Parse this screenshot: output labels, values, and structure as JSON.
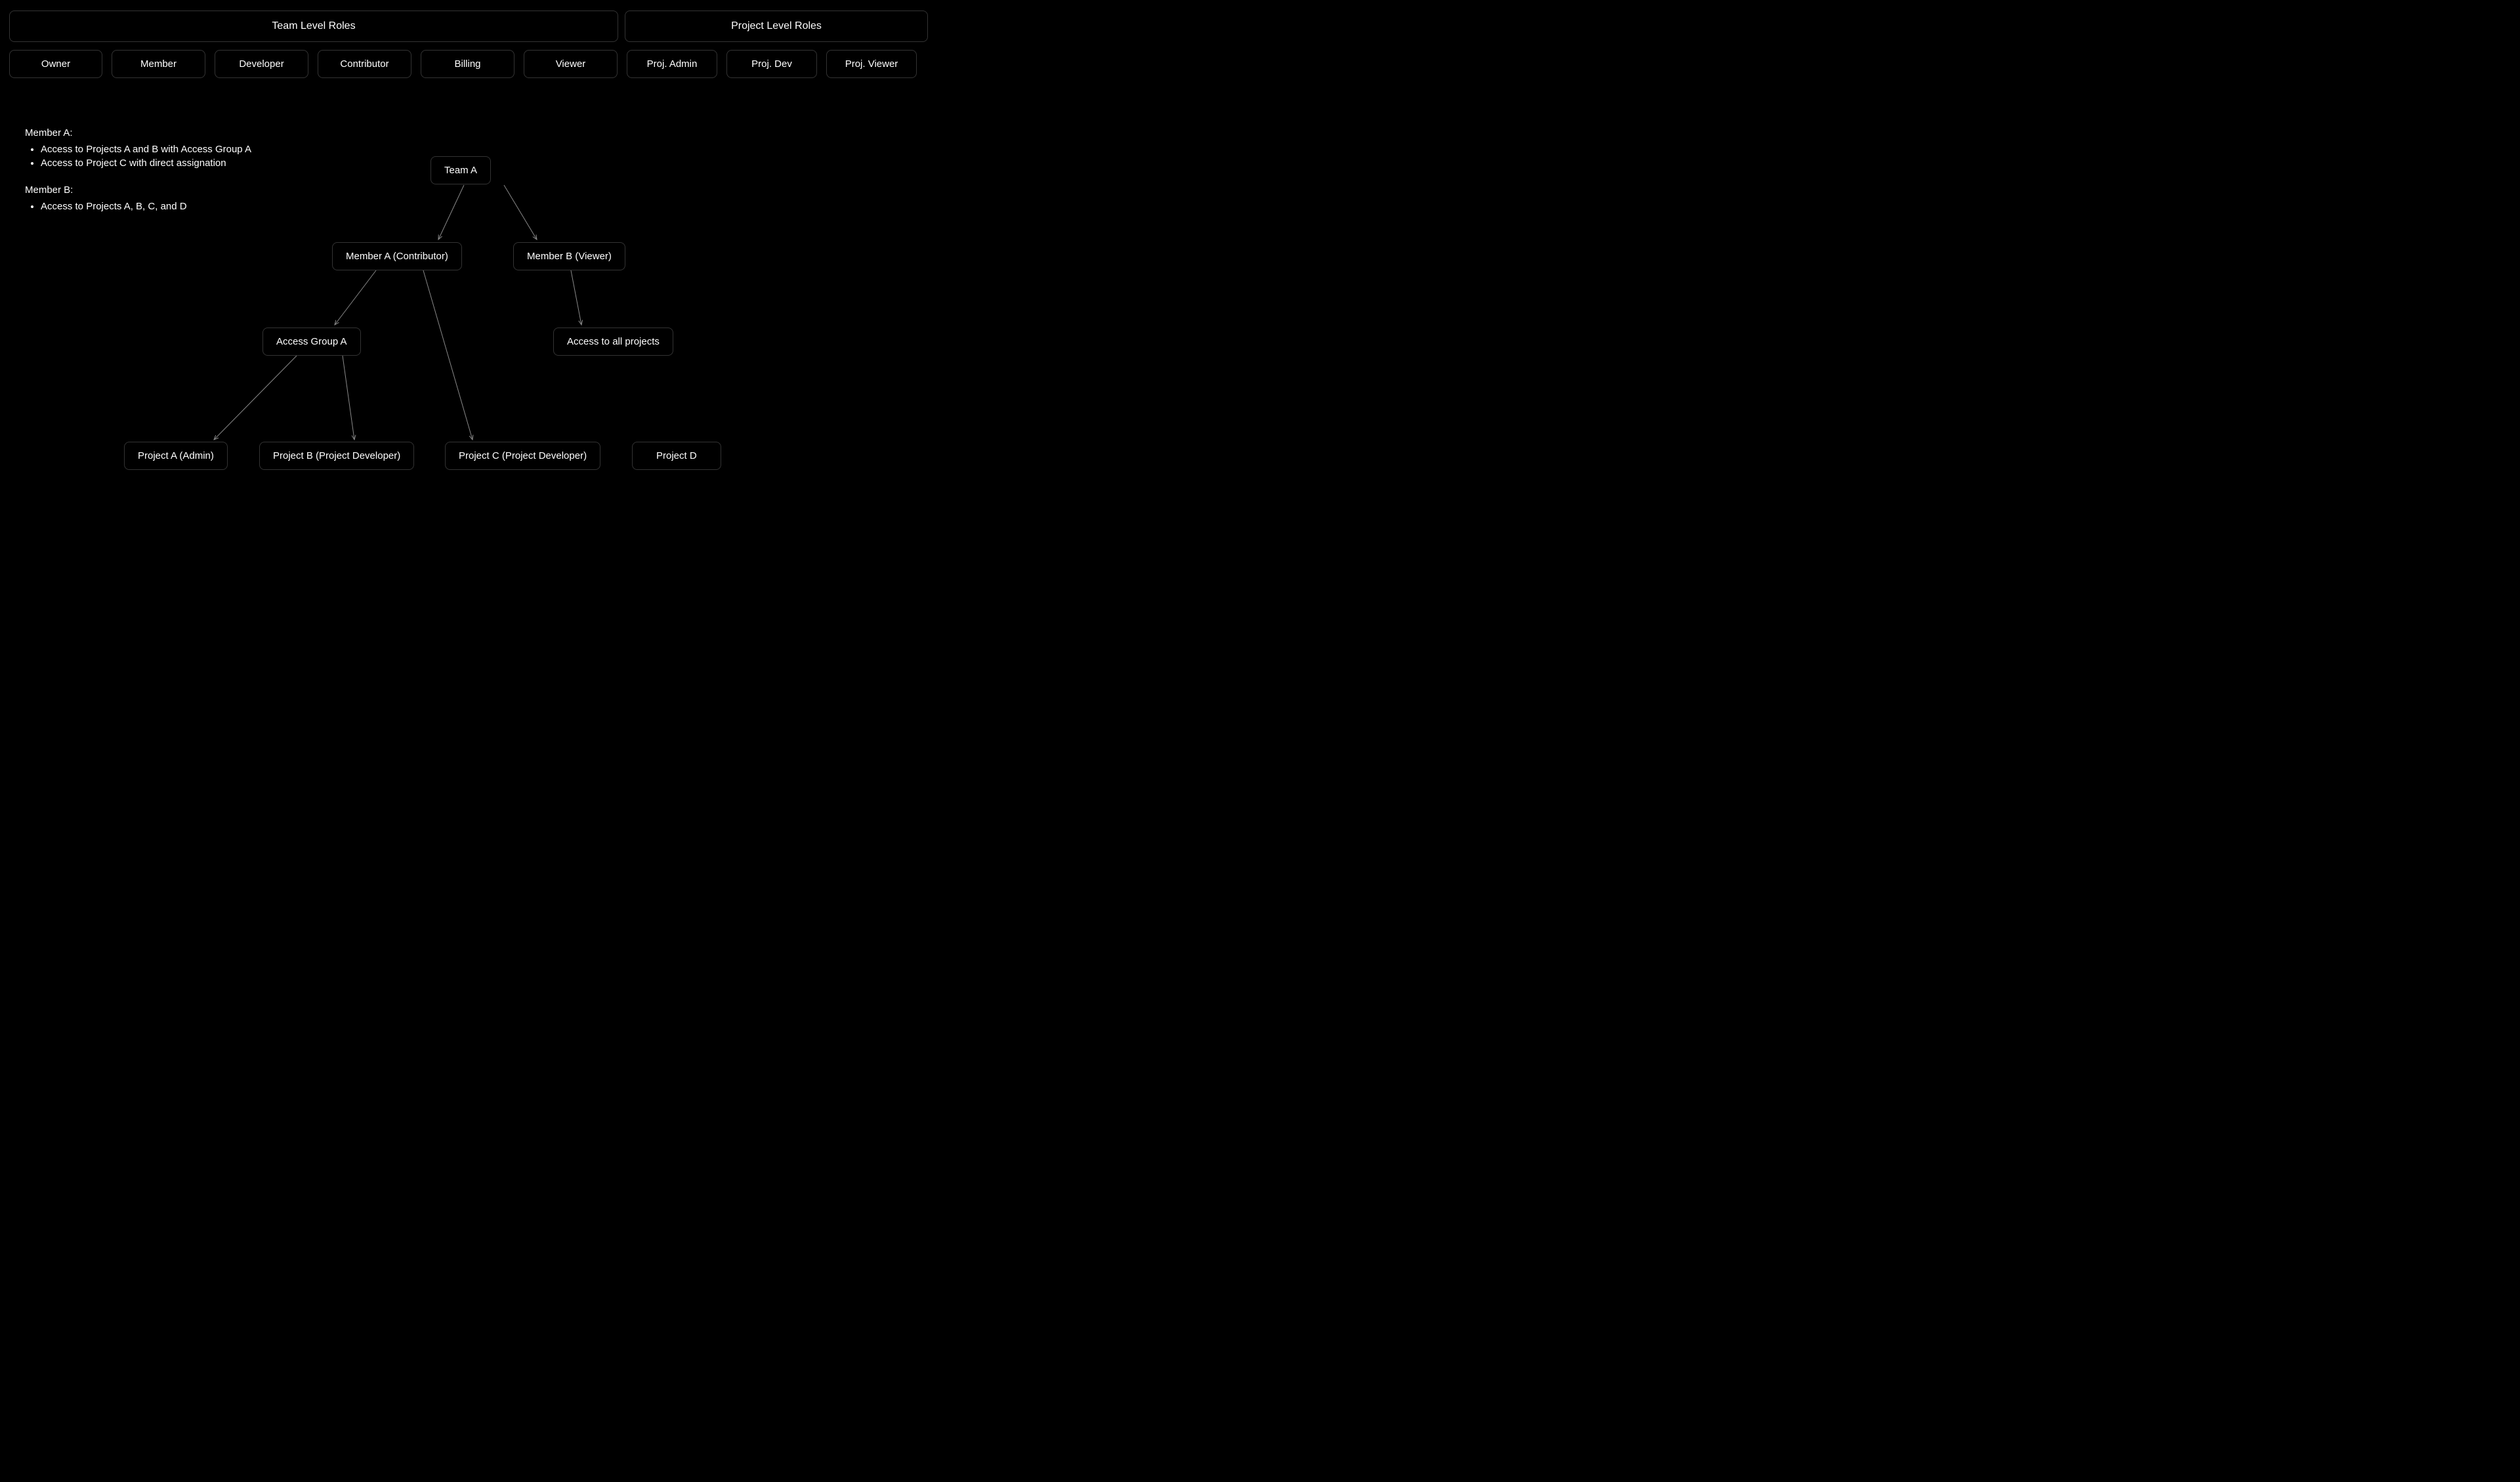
{
  "headers": {
    "team": "Team Level Roles",
    "project": "Project Level Roles"
  },
  "teamRoles": {
    "owner": "Owner",
    "member": "Member",
    "developer": "Developer",
    "contributor": "Contributor",
    "billing": "Billing",
    "viewer": "Viewer"
  },
  "projectRoles": {
    "admin": "Proj. Admin",
    "dev": "Proj. Dev",
    "viewer": "Proj. Viewer"
  },
  "description": {
    "memberA": {
      "title": "Member A:",
      "item1": "Access to Projects A and B with Access Group A",
      "item2": "Access to Project C with direct assignation"
    },
    "memberB": {
      "title": "Member B:",
      "item1": "Access to Projects A, B, C, and D"
    }
  },
  "nodes": {
    "teamA": "Team A",
    "memberA": "Member A (Contributor)",
    "memberB": "Member B (Viewer)",
    "accessGroupA": "Access Group A",
    "allProjects": "Access to all projects",
    "projectA": "Project A (Admin)",
    "projectB": "Project B (Project Developer)",
    "projectC": "Project C (Project Developer)",
    "projectD": "Project D"
  }
}
